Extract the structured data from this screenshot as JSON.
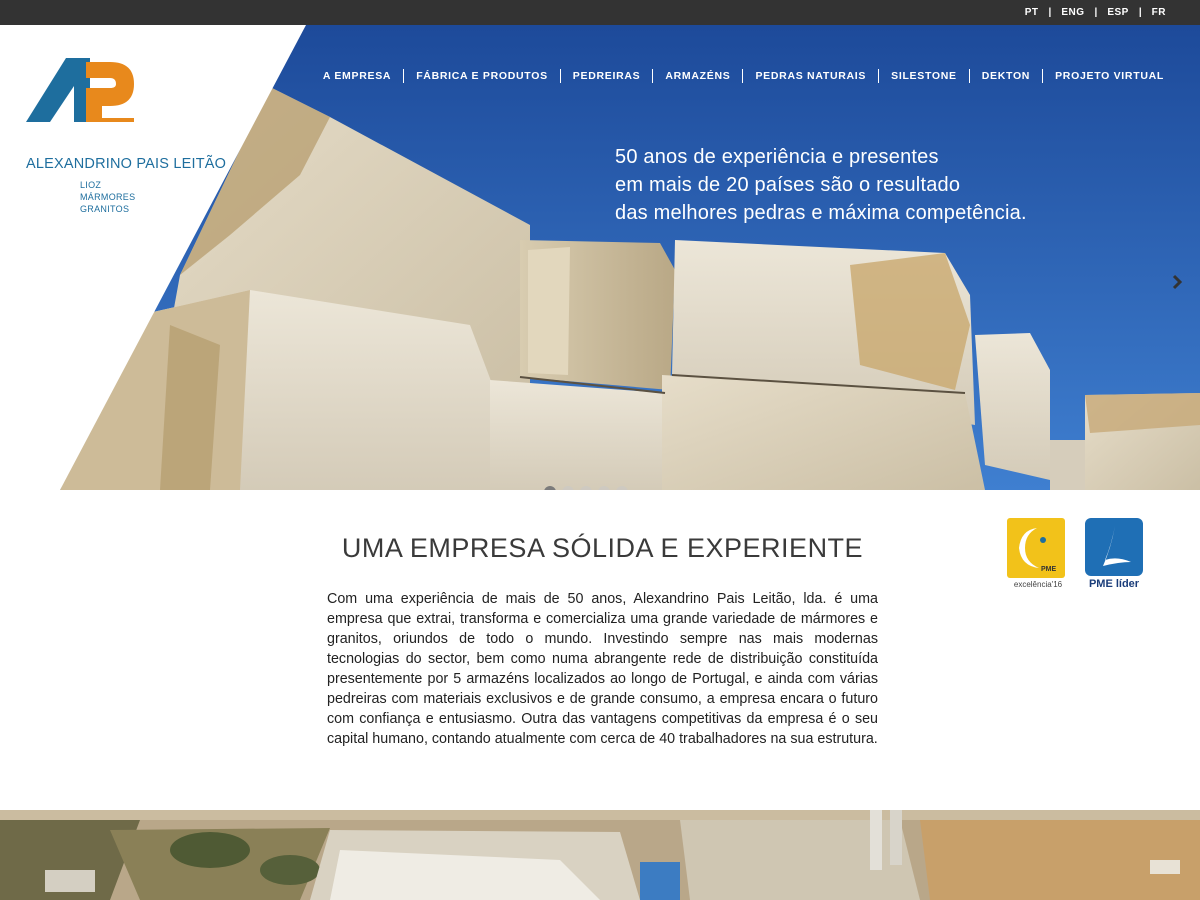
{
  "languages": [
    "PT",
    "ENG",
    "ESP",
    "FR"
  ],
  "logo": {
    "name": "ALEXANDRINO PAIS LEITÃO",
    "sub": [
      "LIOZ",
      "MÁRMORES",
      "GRANITOS"
    ]
  },
  "nav": [
    "A EMPRESA",
    "FÁBRICA E PRODUTOS",
    "PEDREIRAS",
    "ARMAZÉNS",
    "PEDRAS NATURAIS",
    "SILESTONE",
    "DEKTON",
    "PROJETO VIRTUAL"
  ],
  "hero": {
    "tagline": [
      "50 anos de experiência e presentes",
      "em mais de 20 países são o resultado",
      "das melhores pedras e máxima competência."
    ],
    "slide_count": 5,
    "active_slide": 1
  },
  "section": {
    "heading": "UMA EMPRESA SÓLIDA E EXPERIENTE",
    "paragraph": "Com uma experiência de mais de 50 anos, Alexandrino Pais Leitão, lda. é uma empresa que extrai, transforma e comercializa uma grande variedade de mármores e granitos, oriundos de todo o mundo. Investindo sempre nas mais modernas tecnologias do sector, bem como numa abrangente rede de distribuição constituída presentemente por 5 armazéns localizados ao longo de Portugal, e ainda com várias pedreiras com materiais exclusivos e de grande consumo, a empresa encara o futuro com confiança e entusiasmo. Outra das vantagens competitivas da empresa é o seu capital humano, contando atualmente com cerca de 40 trabalhadores na sua estrutura."
  },
  "badges": {
    "pme_excelencia": {
      "inner": "PME",
      "caption": "excelência'16"
    },
    "pme_lider": {
      "caption": "PME líder"
    }
  },
  "colors": {
    "topbar": "#333333",
    "sky": "#1f4f9e",
    "brand_blue": "#1e6e9e",
    "brand_orange": "#e8891c",
    "badge_yellow": "#f2c21a",
    "badge_blue": "#1f6fb5"
  }
}
